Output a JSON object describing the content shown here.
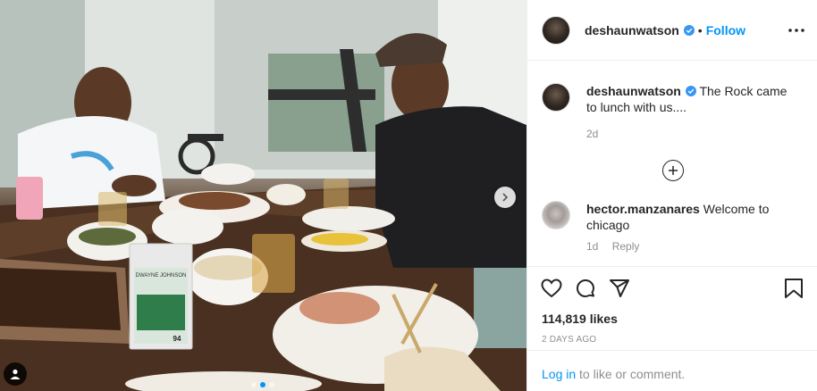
{
  "post": {
    "author": "deshaunwatson",
    "follow_label": "Follow",
    "bullet": "•",
    "caption_author": "deshaunwatson",
    "caption_text": "The Rock came to lunch with us....",
    "caption_age": "2d",
    "comment_author": "hector.manzanares",
    "comment_text": "Welcome to chicago",
    "comment_age": "1d",
    "comment_reply": "Reply",
    "likes": "114,819 likes",
    "posted": "2 days ago",
    "login_link": "Log in",
    "login_rest": "to like or comment.",
    "card_name": "DWAYNE JOHNSON",
    "card_number": "94"
  },
  "carousel": {
    "total": 3,
    "active_index": 1
  },
  "icons": {
    "verified": "verified-badge-icon",
    "more": "more-options-icon",
    "add": "plus-circle-icon",
    "like": "heart-icon",
    "comment": "comment-icon",
    "share": "paper-plane-icon",
    "save": "bookmark-icon",
    "next": "chevron-right-icon",
    "tag": "user-tag-icon"
  },
  "colors": {
    "accent": "#0095f6",
    "text": "#262626",
    "muted": "#8e8e8e",
    "border": "#efefef"
  }
}
